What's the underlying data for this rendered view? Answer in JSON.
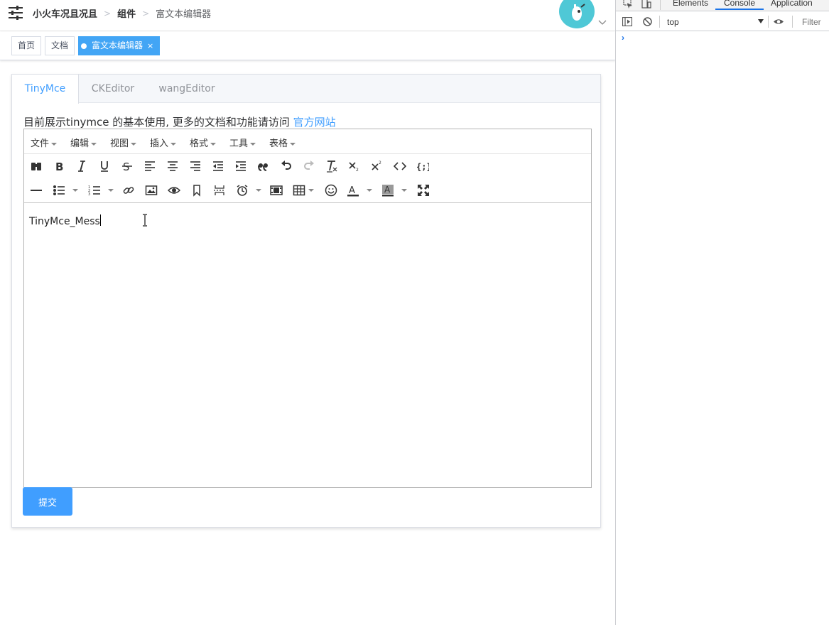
{
  "header": {
    "breadcrumb": [
      "小火车况且况且",
      "组件",
      "富文本编辑器"
    ],
    "avatar_alt": "avatar"
  },
  "tags": [
    {
      "label": "首页",
      "active": false
    },
    {
      "label": "文档",
      "active": false
    },
    {
      "label": "富文本编辑器",
      "active": true,
      "close": "×"
    }
  ],
  "tabs": [
    {
      "label": "TinyMce",
      "active": true
    },
    {
      "label": "CKEditor",
      "active": false
    },
    {
      "label": "wangEditor",
      "active": false
    }
  ],
  "intro": {
    "text": "目前展示tinymce 的基本使用, 更多的文档和功能请访问 ",
    "link": "官方网站"
  },
  "editor": {
    "menus": [
      "文件",
      "编辑",
      "视图",
      "插入",
      "格式",
      "工具",
      "表格"
    ],
    "toolbar_row1": [
      "search-replace-icon",
      "bold-icon",
      "italic-icon",
      "underline-icon",
      "strikethrough-icon",
      "align-left-icon",
      "align-center-icon",
      "align-right-icon",
      "outdent-icon",
      "indent-icon",
      "blockquote-icon",
      "undo-icon",
      "redo-icon",
      "remove-format-icon",
      "subscript-icon",
      "superscript-icon",
      "code-icon",
      "codesample-icon"
    ],
    "toolbar_row2": [
      "hr-icon",
      "bullet-list-icon",
      "numbered-list-icon",
      "link-icon",
      "image-icon",
      "preview-icon",
      "bookmark-icon",
      "page-break-icon",
      "insert-datetime-icon",
      "media-icon",
      "table-icon",
      "emoticons-icon",
      "text-color-icon",
      "background-color-icon",
      "fullscreen-icon"
    ],
    "content": "TinyMce_Mess"
  },
  "submit_label": "提交",
  "devtools": {
    "tabs": [
      "Elements",
      "Console",
      "Application"
    ],
    "active_tab": "Console",
    "context": "top",
    "filter_placeholder": "Filter",
    "prompt": "›"
  },
  "colors": {
    "accent": "#409eff",
    "tag_active": "#42a5f5",
    "avatar_bg": "#4fc8d6"
  }
}
